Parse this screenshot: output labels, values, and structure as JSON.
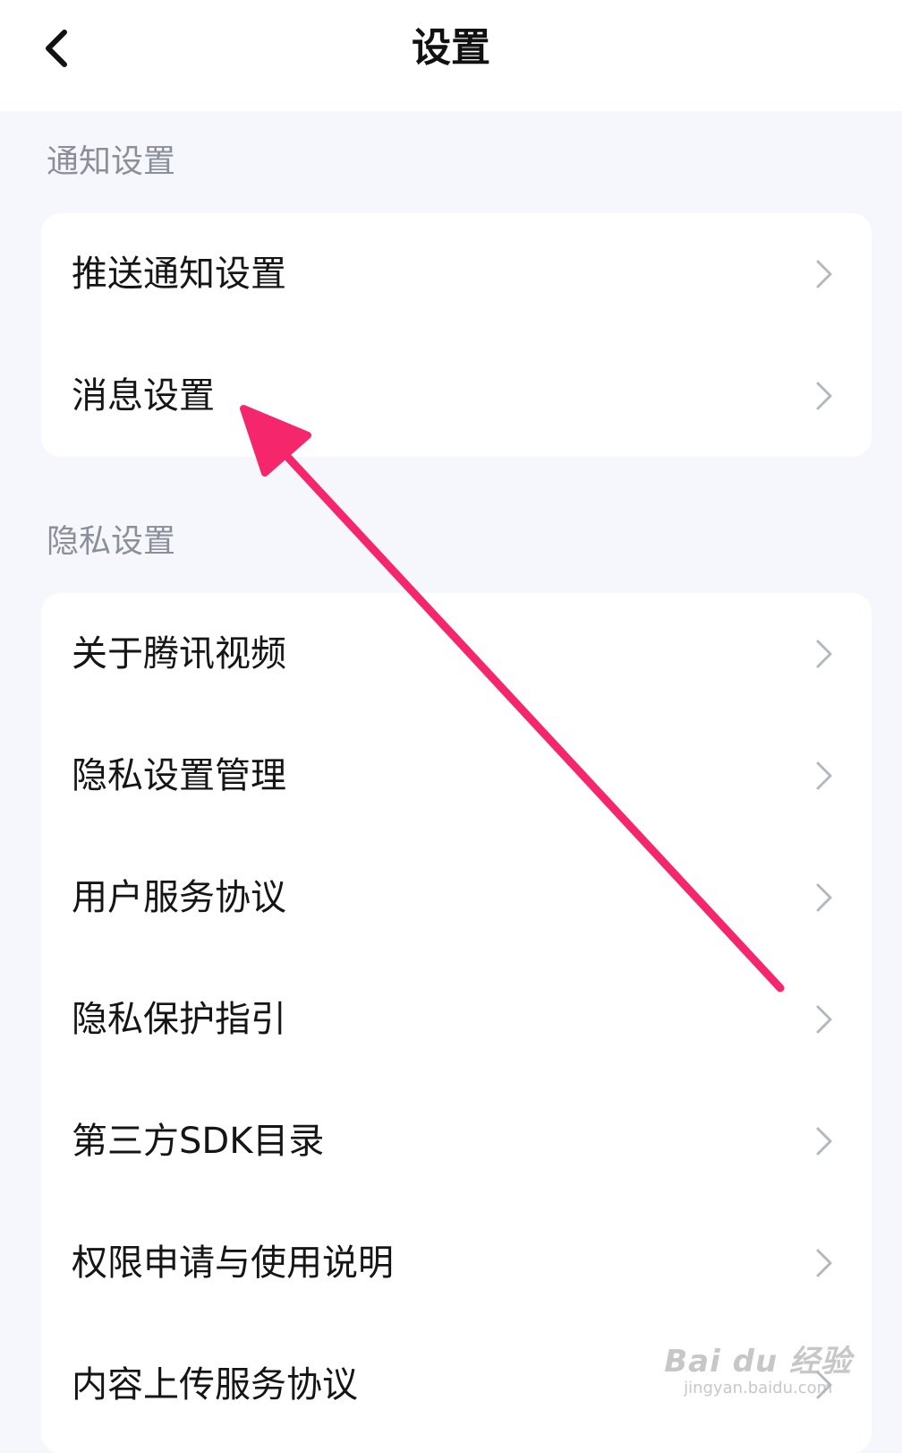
{
  "header": {
    "title": "设置",
    "back_icon": "chevron-left-icon"
  },
  "sections": [
    {
      "label": "通知设置",
      "items": [
        "推送通知设置",
        "消息设置"
      ]
    },
    {
      "label": "隐私设置",
      "items": [
        "关于腾讯视频",
        "隐私设置管理",
        "用户服务协议",
        "隐私保护指引",
        "第三方SDK目录",
        "权限申请与使用说明",
        "内容上传服务协议"
      ]
    }
  ],
  "annotation": {
    "type": "arrow",
    "color": "#f5266b",
    "points_to": "消息设置"
  },
  "watermark": {
    "brand": "Bai du 经验",
    "url": "jingyan.baidu.com"
  },
  "colors": {
    "background": "#f5f7fd",
    "card": "#ffffff",
    "section_label": "#8c8f99",
    "chevron": "#b5b8c0"
  }
}
